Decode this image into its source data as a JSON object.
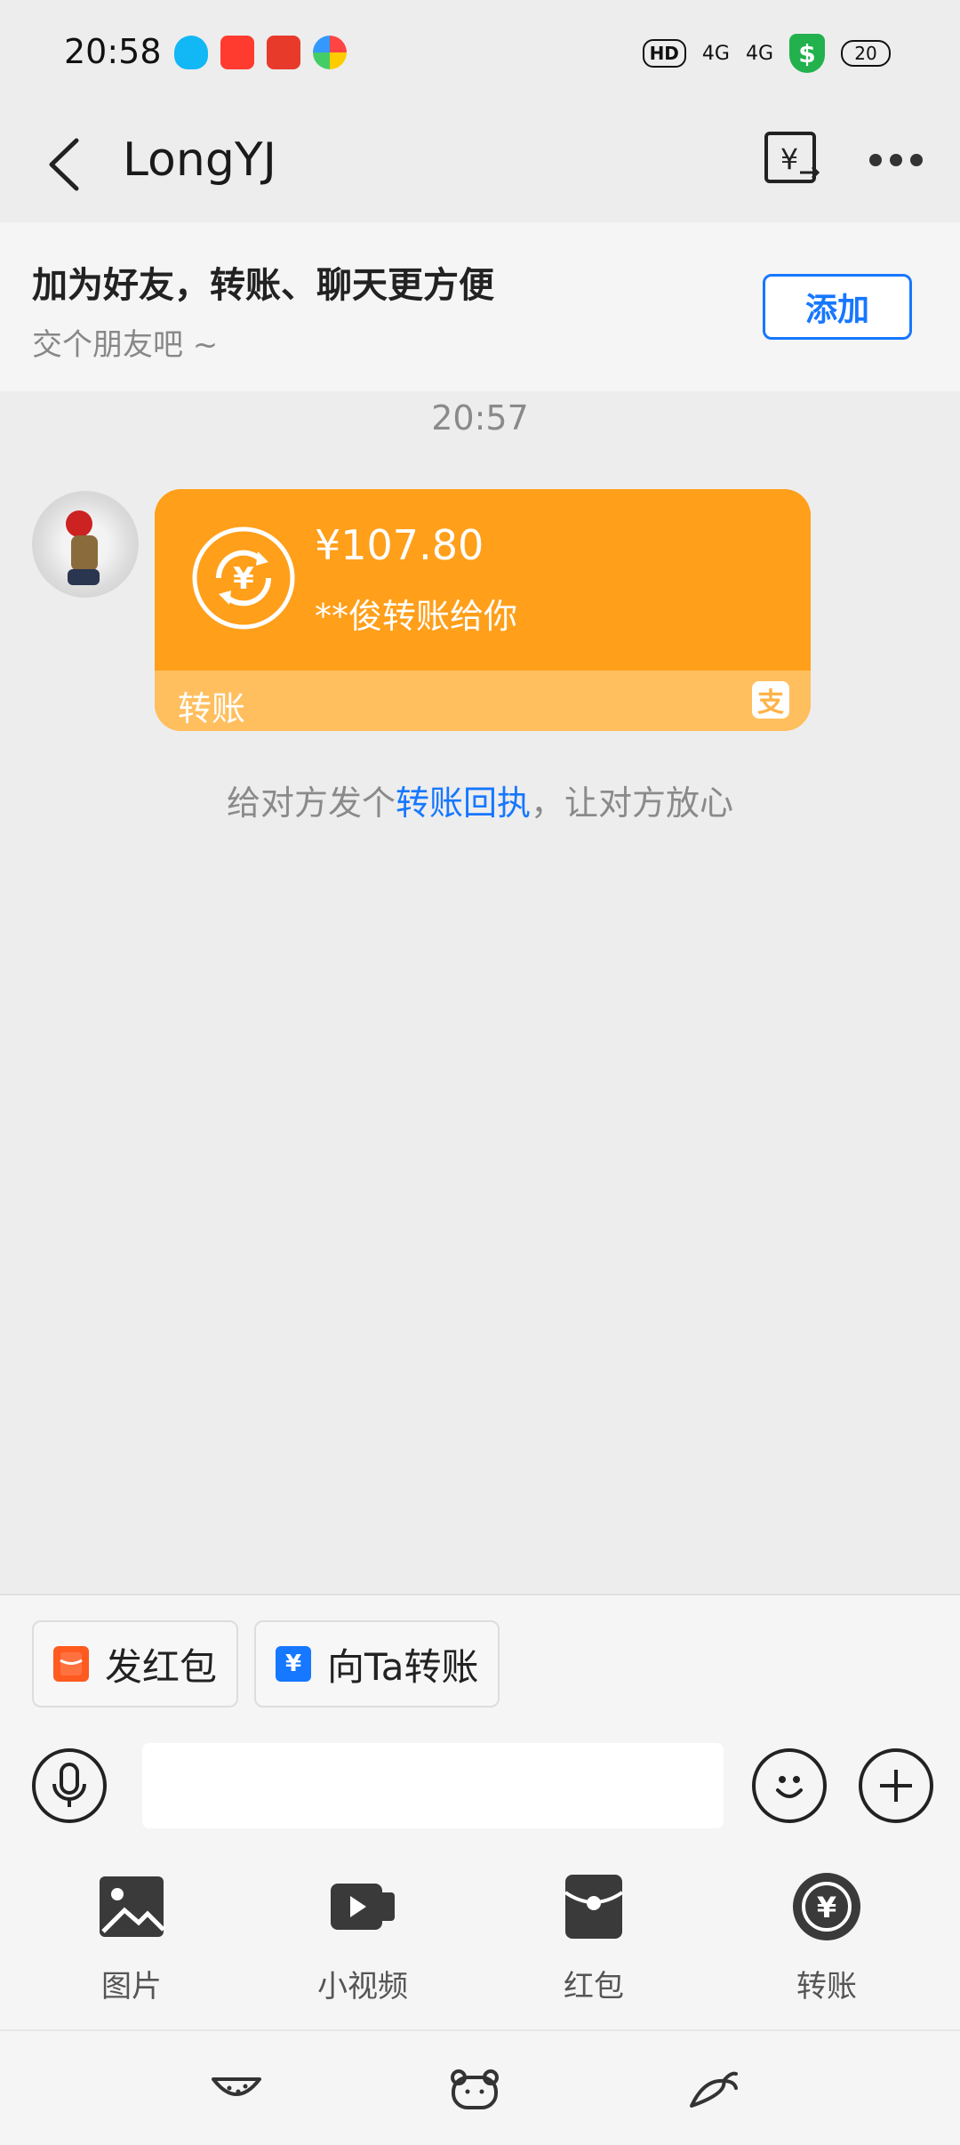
{
  "status_bar": {
    "time": "20:58",
    "hd_label": "HD",
    "signal1": "4G",
    "signal2": "4G",
    "shield_label": "$",
    "battery": "20"
  },
  "header": {
    "back_icon": "chevron-left-icon",
    "title": "LongYJ",
    "transfer_icon": "yuan-transfer-icon",
    "more_icon": "more-dots-icon"
  },
  "banner": {
    "title": "加为好友，转账、聊天更方便",
    "subtitle": "交个朋友吧 ~",
    "add_label": "添加"
  },
  "chat": {
    "timestamp": "20:57",
    "message": {
      "amount": "¥107.80",
      "description": "**俊转账给你",
      "card_label": "转账",
      "alipay_glyph": "支"
    },
    "tip_prefix": "给对方发个",
    "tip_link": "转账回执",
    "tip_suffix": "，让对方放心"
  },
  "quick_actions": [
    {
      "label": "发红包",
      "icon": "red-packet-icon"
    },
    {
      "label": "向Ta转账",
      "icon": "transfer-yuan-icon",
      "glyph": "¥"
    }
  ],
  "input": {
    "placeholder": ""
  },
  "tools": [
    {
      "label": "图片",
      "icon": "image-icon"
    },
    {
      "label": "小视频",
      "icon": "video-icon"
    },
    {
      "label": "红包",
      "icon": "red-packet-icon"
    },
    {
      "label": "转账",
      "icon": "transfer-icon"
    }
  ],
  "colors": {
    "accent_blue": "#1677ff",
    "card_orange": "#ff9f1a",
    "card_footer": "#ffbf5e",
    "background": "#ededed"
  }
}
